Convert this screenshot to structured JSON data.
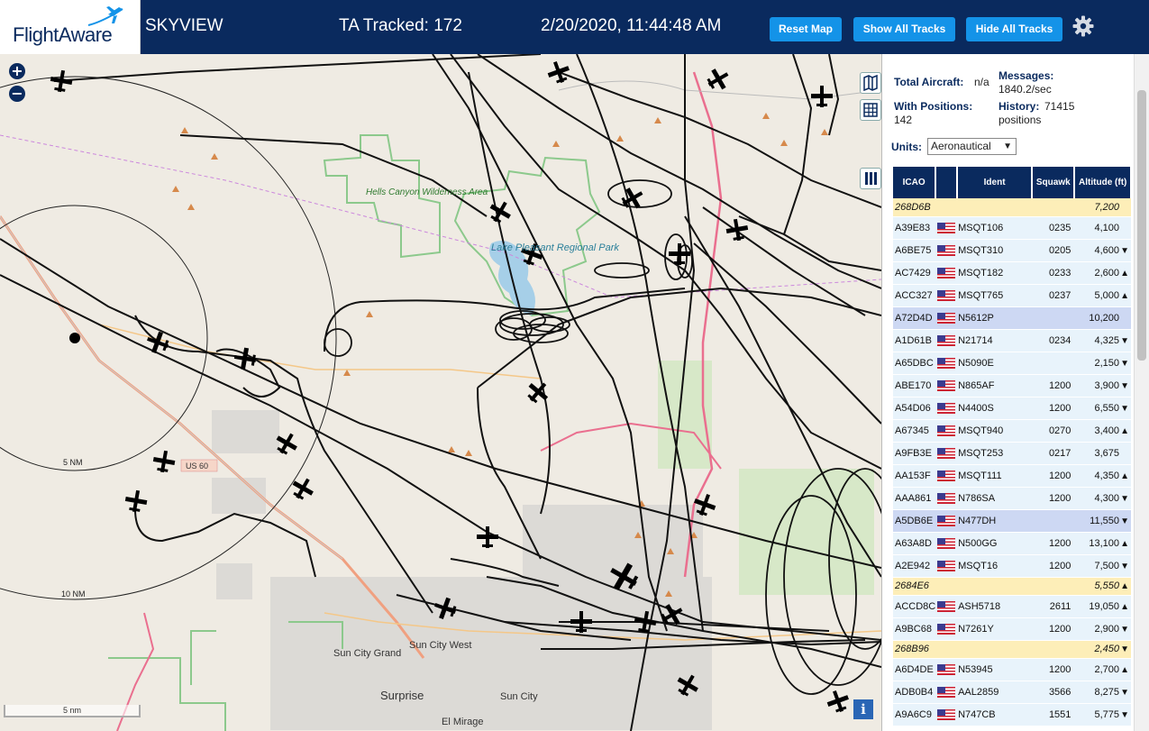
{
  "header": {
    "logo_text": "FlightAware",
    "app_name": "SKYVIEW",
    "tracked": "TA Tracked: 172",
    "timestamp": "2/20/2020, 11:44:48 AM",
    "reset_map_label": "Reset Map",
    "show_all_label": "Show All Tracks",
    "hide_all_label": "Hide All Tracks"
  },
  "stats": {
    "total_aircraft_label": "Total Aircraft:",
    "total_aircraft_value": "n/a",
    "with_positions_label": "With Positions:",
    "with_positions_value": "142",
    "messages_label": "Messages:",
    "messages_value": "1840.2/sec",
    "history_label": "History:",
    "history_value_a": "71415",
    "history_value_b": "positions"
  },
  "units": {
    "label": "Units:",
    "selected": "Aeronautical"
  },
  "table": {
    "headers": {
      "icao": "ICAO",
      "ident": "Ident",
      "squawk": "Squawk",
      "altitude": "Altitude (ft)"
    },
    "rows": [
      {
        "icao": "268D6B",
        "flag": false,
        "ident": "",
        "squawk": "",
        "alt": "7,200",
        "trend": "",
        "kind": "tisb"
      },
      {
        "icao": "A39E83",
        "flag": true,
        "ident": "MSQT106",
        "squawk": "0235",
        "alt": "4,100",
        "trend": "",
        "kind": "norm"
      },
      {
        "icao": "A6BE75",
        "flag": true,
        "ident": "MSQT310",
        "squawk": "0205",
        "alt": "4,600",
        "trend": "▼",
        "kind": "norm"
      },
      {
        "icao": "AC7429",
        "flag": true,
        "ident": "MSQT182",
        "squawk": "0233",
        "alt": "2,600",
        "trend": "▲",
        "kind": "norm"
      },
      {
        "icao": "ACC327",
        "flag": true,
        "ident": "MSQT765",
        "squawk": "0237",
        "alt": "5,000",
        "trend": "▲",
        "kind": "norm"
      },
      {
        "icao": "A72D4D",
        "flag": true,
        "ident": "N5612P",
        "squawk": "",
        "alt": "10,200",
        "trend": "",
        "kind": "sel"
      },
      {
        "icao": "A1D61B",
        "flag": true,
        "ident": "N21714",
        "squawk": "0234",
        "alt": "4,325",
        "trend": "▼",
        "kind": "norm"
      },
      {
        "icao": "A65DBC",
        "flag": true,
        "ident": "N5090E",
        "squawk": "",
        "alt": "2,150",
        "trend": "▼",
        "kind": "norm"
      },
      {
        "icao": "ABE170",
        "flag": true,
        "ident": "N865AF",
        "squawk": "1200",
        "alt": "3,900",
        "trend": "▼",
        "kind": "norm"
      },
      {
        "icao": "A54D06",
        "flag": true,
        "ident": "N4400S",
        "squawk": "1200",
        "alt": "6,550",
        "trend": "▼",
        "kind": "norm"
      },
      {
        "icao": "A67345",
        "flag": true,
        "ident": "MSQT940",
        "squawk": "0270",
        "alt": "3,400",
        "trend": "▲",
        "kind": "norm"
      },
      {
        "icao": "A9FB3E",
        "flag": true,
        "ident": "MSQT253",
        "squawk": "0217",
        "alt": "3,675",
        "trend": "",
        "kind": "norm"
      },
      {
        "icao": "AA153F",
        "flag": true,
        "ident": "MSQT111",
        "squawk": "1200",
        "alt": "4,350",
        "trend": "▲",
        "kind": "norm"
      },
      {
        "icao": "AAA861",
        "flag": true,
        "ident": "N786SA",
        "squawk": "1200",
        "alt": "4,300",
        "trend": "▼",
        "kind": "norm"
      },
      {
        "icao": "A5DB6E",
        "flag": true,
        "ident": "N477DH",
        "squawk": "",
        "alt": "11,550",
        "trend": "▼",
        "kind": "sel"
      },
      {
        "icao": "A63A8D",
        "flag": true,
        "ident": "N500GG",
        "squawk": "1200",
        "alt": "13,100",
        "trend": "▲",
        "kind": "norm"
      },
      {
        "icao": "A2E942",
        "flag": true,
        "ident": "MSQT16",
        "squawk": "1200",
        "alt": "7,500",
        "trend": "▼",
        "kind": "norm"
      },
      {
        "icao": "2684E6",
        "flag": false,
        "ident": "",
        "squawk": "",
        "alt": "5,550",
        "trend": "▲",
        "kind": "tisb"
      },
      {
        "icao": "ACCD8C",
        "flag": true,
        "ident": "ASH5718",
        "squawk": "2611",
        "alt": "19,050",
        "trend": "▲",
        "kind": "norm"
      },
      {
        "icao": "A9BC68",
        "flag": true,
        "ident": "N7261Y",
        "squawk": "1200",
        "alt": "2,900",
        "trend": "▼",
        "kind": "norm"
      },
      {
        "icao": "268B96",
        "flag": false,
        "ident": "",
        "squawk": "",
        "alt": "2,450",
        "trend": "▼",
        "kind": "tisb"
      },
      {
        "icao": "A6D4DE",
        "flag": true,
        "ident": "N53945",
        "squawk": "1200",
        "alt": "2,700",
        "trend": "▲",
        "kind": "norm"
      },
      {
        "icao": "ADB0B4",
        "flag": true,
        "ident": "AAL2859",
        "squawk": "3566",
        "alt": "8,275",
        "trend": "▼",
        "kind": "norm"
      },
      {
        "icao": "A9A6C9",
        "flag": true,
        "ident": "N747CB",
        "squawk": "1551",
        "alt": "5,775",
        "trend": "▼",
        "kind": "norm"
      }
    ]
  },
  "map": {
    "labels": {
      "hells_canyon": "Hells Canyon Wilderness Area",
      "lake_pleasant": "Lake Pleasant Regional Park",
      "sun_city_grand": "Sun City Grand",
      "sun_city_west": "Sun City West",
      "sun_city": "Sun City",
      "surprise": "Surprise",
      "el_mirage": "El Mirage",
      "ring_5": "5 NM",
      "ring_10": "10 NM",
      "us60": "US 60",
      "scale": "5 nm"
    },
    "colors": {
      "land": "#efebe3",
      "water": "#a6cfe8",
      "park_border": "#8cc98c",
      "track": "#111111"
    }
  }
}
